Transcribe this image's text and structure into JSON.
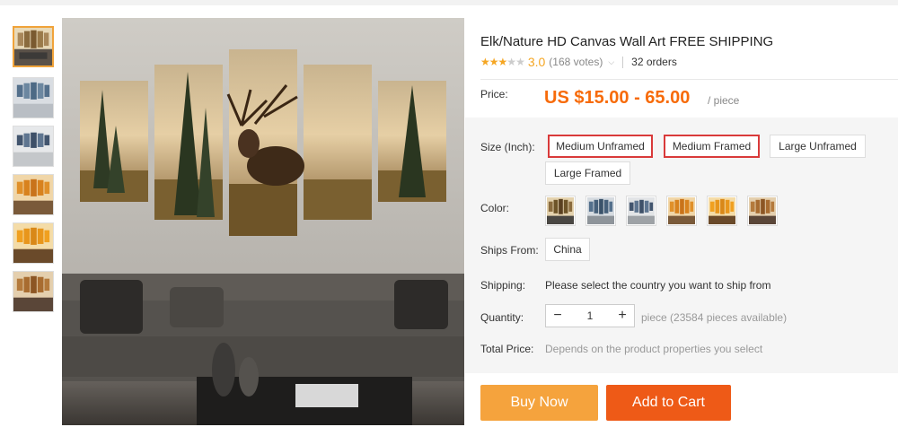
{
  "product": {
    "title": "Elk/Nature HD Canvas Wall Art FREE SHIPPING",
    "rating": {
      "stars": 3,
      "value": "3.0",
      "votes": "(168 votes)",
      "orders": "32 orders"
    },
    "price": {
      "label": "Price:",
      "value": "US $15.00 - 65.00",
      "unit": "/ piece"
    }
  },
  "options": {
    "size": {
      "label": "Size (Inch):",
      "choices": [
        "Medium Unframed",
        "Medium Framed",
        "Large Unframed",
        "Large Framed"
      ],
      "highlighted": [
        "Medium Unframed",
        "Medium Framed"
      ]
    },
    "color": {
      "label": "Color:",
      "swatch_count": 6
    },
    "ships_from": {
      "label": "Ships From:",
      "choices": [
        "China"
      ]
    },
    "shipping": {
      "label": "Shipping:",
      "text": "Please select the country you want to ship from"
    },
    "quantity": {
      "label": "Quantity:",
      "value": "1",
      "note": "piece (23584 pieces available)",
      "minus": "−",
      "plus": "+"
    },
    "total": {
      "label": "Total Price:",
      "text": "Depends on the product properties you select"
    }
  },
  "actions": {
    "buy_now": "Buy Now",
    "add_to_cart": "Add to Cart"
  },
  "gallery": {
    "thumbnail_count": 6,
    "active_index": 0
  },
  "colors": {
    "price": "#f76b0a",
    "buy": "#f5a33d",
    "cart": "#ee5a17",
    "highlight": "#d93a3a",
    "star": "#f5a623"
  }
}
